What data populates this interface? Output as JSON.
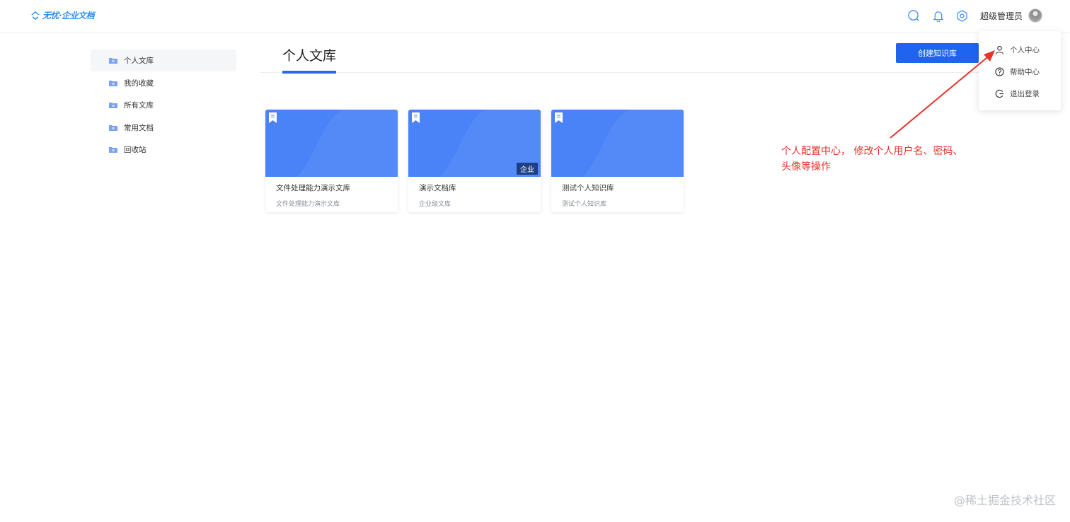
{
  "header": {
    "logo_text": "无忧·企业文档",
    "user_name": "超级管理员",
    "icons": [
      "search-icon",
      "bell-icon",
      "gear-icon"
    ]
  },
  "sidebar": {
    "items": [
      {
        "label": "个人文库",
        "active": true
      },
      {
        "label": "我的收藏",
        "active": false
      },
      {
        "label": "所有文库",
        "active": false
      },
      {
        "label": "常用文档",
        "active": false
      },
      {
        "label": "回收站",
        "active": false
      }
    ]
  },
  "main": {
    "title": "个人文库",
    "create_button": "创建知识库",
    "cards": [
      {
        "title": "文件处理能力演示文库",
        "desc": "文件处理能力演示文库",
        "badge": ""
      },
      {
        "title": "演示文档库",
        "desc": "企业级文库",
        "badge": "企业"
      },
      {
        "title": "测试个人知识库",
        "desc": "测试个人知识库",
        "badge": ""
      }
    ]
  },
  "dropdown": {
    "items": [
      {
        "label": "个人中心",
        "icon": "user-icon"
      },
      {
        "label": "帮助中心",
        "icon": "question-icon"
      },
      {
        "label": "退出登录",
        "icon": "logout-icon"
      }
    ]
  },
  "annotation": {
    "line1": "个人配置中心， 修改个人用户名、密码、",
    "line2": "头像等操作"
  },
  "watermark": "@稀土掘金技术社区",
  "colors": {
    "primary": "#1f64f1",
    "card_cover": "#4a83f7",
    "annotation": "#e8322b"
  }
}
